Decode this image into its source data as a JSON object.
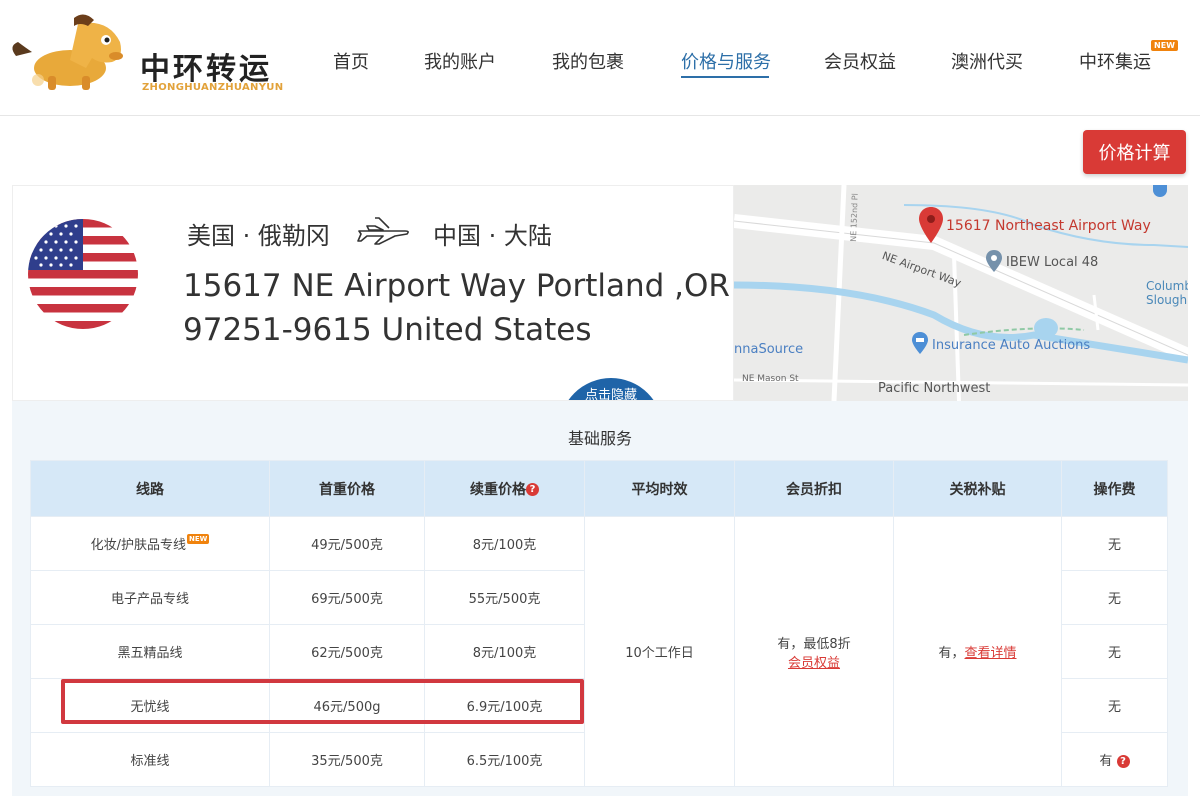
{
  "brand": {
    "name_cn": "中环转运",
    "name_en": "ZHONGHUANZHUANYUN"
  },
  "nav": {
    "items": [
      "首页",
      "我的账户",
      "我的包裹",
      "价格与服务",
      "会员权益",
      "澳洲代买",
      "中环集运"
    ],
    "active": "价格与服务",
    "new_badge": "NEW"
  },
  "calc_button": "价格计算",
  "address": {
    "from": "美国 · 俄勒冈",
    "to": "中国 · 大陆",
    "line1": "15617 NE Airport Way Portland ,OR",
    "line2": "97251-9615 United States",
    "hide_button": "点击隐藏"
  },
  "map": {
    "pin_label": "15617 Northeast Airport Way",
    "road_label": "NE Airport Way",
    "street_152": "NE 152nd Pl",
    "ibew": "IBEW Local 48",
    "columbia": "Columb Slough",
    "insurance": "Insurance Auto Auctions",
    "source": "nnaSource",
    "mason": "NE Mason St",
    "pnw": "Pacific Northwest"
  },
  "services": {
    "title": "基础服务",
    "headers": [
      "线路",
      "首重价格",
      "续重价格",
      "平均时效",
      "会员折扣",
      "关税补贴",
      "操作费"
    ],
    "rows": [
      {
        "route": "化妆/护肤品专线",
        "first": "49元/500克",
        "cont": "8元/100克",
        "fee": "无"
      },
      {
        "route": "电子产品专线",
        "first": "69元/500克",
        "cont": "55元/500克",
        "fee": "无"
      },
      {
        "route": "黑五精品线",
        "first": "62元/500克",
        "cont": "8元/100克",
        "fee": "无"
      },
      {
        "route": "无忧线",
        "first": "46元/500g",
        "cont": "6.9元/100克",
        "fee": "无"
      },
      {
        "route": "标准线",
        "first": "35元/500克",
        "cont": "6.5元/100克",
        "fee": "有"
      }
    ],
    "avg_time": "10个工作日",
    "discount_text": "有，最低8折",
    "discount_link": "会员权益",
    "tariff_text": "有，",
    "tariff_link": "查看详情",
    "new_tag": "NEW"
  },
  "colors": {
    "accent_blue": "#2d6fa8",
    "accent_red": "#d93a36",
    "header_bg": "#d6e8f7",
    "brand_orange": "#e2a23a"
  }
}
